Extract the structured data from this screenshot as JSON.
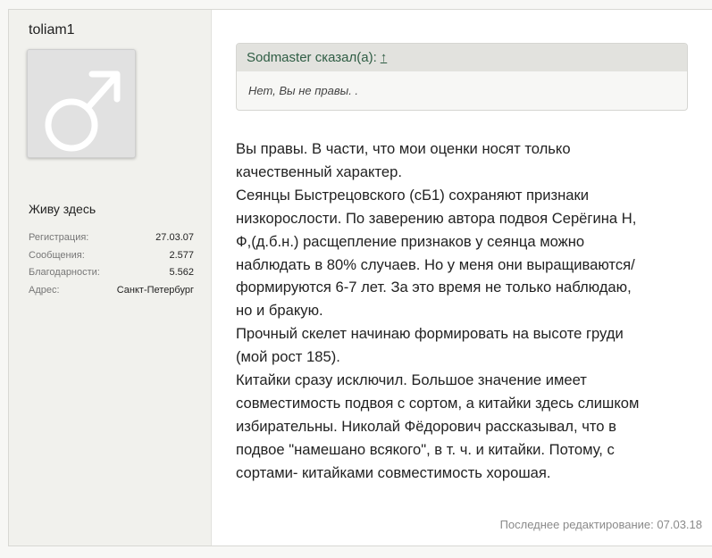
{
  "user": {
    "name": "toliam1",
    "avatar_icon": "male-symbol-icon",
    "status": "Живу здесь",
    "stats": [
      {
        "label": "Регистрация:",
        "value": "27.03.07"
      },
      {
        "label": "Сообщения:",
        "value": "2.577"
      },
      {
        "label": "Благодарности:",
        "value": "5.562"
      },
      {
        "label": "Адрес:",
        "value": "Санкт-Петербург"
      }
    ]
  },
  "quote": {
    "header": "Sodmaster сказал(а):",
    "arrow": "↑",
    "text": "Нет, Вы не правы. ."
  },
  "message": {
    "lines": [
      "Вы правы. В части, что мои оценки носят только",
      "качественный характер.",
      "Сеянцы Быстрецовского (сБ1) сохраняют признаки",
      "низкорослости. По заверению автора подвоя Серёгина Н,",
      "Ф,(д.б.н.) расщепление признаков у сеянца можно",
      "наблюдать в 80% случаев. Но у меня они выращиваются/",
      "формируются 6-7 лет. За это время не только наблюдаю,",
      "но и бракую.",
      "Прочный скелет начинаю формировать на высоте груди",
      "(мой рост 185).",
      "Китайки сразу исключил. Большое значение имеет",
      "совместимость подвоя с сортом, а китайки здесь слишком",
      "избирательны. Николай Фёдорович рассказывал, что в",
      "подвое \"намешано всякого\", в т. ч. и китайки. Потому, с",
      "сортами- китайками совместимость хорошая."
    ]
  },
  "footer": {
    "edited": "Последнее редактирование: 07.03.18"
  },
  "colors": {
    "quote_header_text": "#2f5d44",
    "sidebar_bg": "#f1f1ed"
  }
}
